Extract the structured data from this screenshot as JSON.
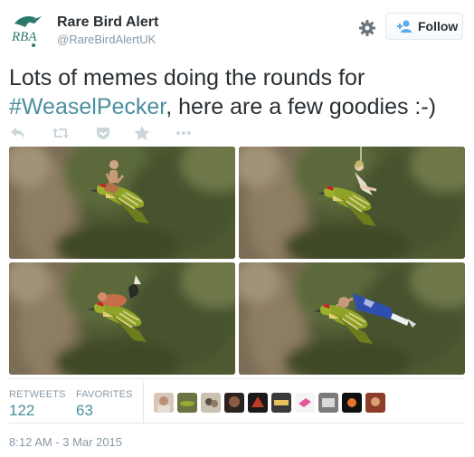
{
  "account": {
    "name": "Rare Bird Alert",
    "handle": "@RareBirdAlertUK",
    "logo_text": "RBA"
  },
  "header": {
    "settings_icon": "gear-icon",
    "follow_label": "Follow",
    "follow_icon": "add-user-icon"
  },
  "tweet": {
    "text_before": "Lots of memes doing the rounds for ",
    "hashtag": "#WeaselPecker",
    "text_after": ", here are a few goodies :-)"
  },
  "actions": [
    "reply-icon",
    "retweet-icon",
    "pocket-icon",
    "favorite-icon",
    "more-icon"
  ],
  "media": [
    {
      "label": "photo-1",
      "rider": "person"
    },
    {
      "label": "photo-2",
      "rider": "wrecking-ball-rider"
    },
    {
      "label": "photo-3",
      "rider": "dog"
    },
    {
      "label": "photo-4",
      "rider": "footballer"
    }
  ],
  "stats": {
    "retweets_label": "RETWEETS",
    "retweets_count": "122",
    "favorites_label": "FAVORITES",
    "favorites_count": "63"
  },
  "favoriters_count": 10,
  "timestamp": "8:12 AM - 3 Mar 2015",
  "colors": {
    "link": "#4a8f9f",
    "text": "#292f33",
    "muted": "#8899a6",
    "border": "#e1e8ed",
    "brand_green": "#2a7a6a"
  }
}
